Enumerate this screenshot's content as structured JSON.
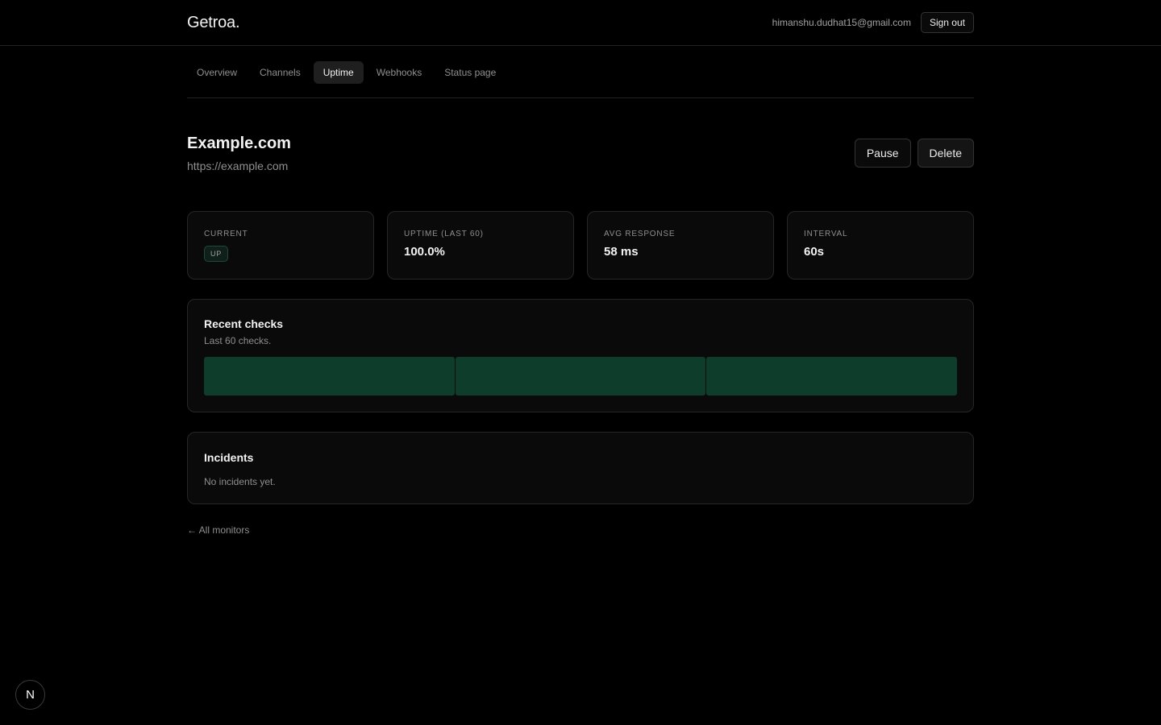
{
  "app": {
    "brand": "Getroa."
  },
  "header": {
    "user_email": "himanshu.dudhat15@gmail.com",
    "signout_label": "Sign out"
  },
  "nav": {
    "tabs": [
      {
        "label": "Overview",
        "active": false
      },
      {
        "label": "Channels",
        "active": false
      },
      {
        "label": "Uptime",
        "active": true
      },
      {
        "label": "Webhooks",
        "active": false
      },
      {
        "label": "Status page",
        "active": false
      }
    ]
  },
  "monitor": {
    "name": "Example.com",
    "url": "https://example.com",
    "pause_label": "Pause",
    "delete_label": "Delete"
  },
  "stats": {
    "current": {
      "label": "Current",
      "status": "UP"
    },
    "uptime": {
      "label": "Uptime (last 60)",
      "value": "100.0%"
    },
    "avg_response": {
      "label": "Avg response",
      "value": "58 ms"
    },
    "interval": {
      "label": "Interval",
      "value": "60s"
    }
  },
  "recent_checks": {
    "title": "Recent checks",
    "subtitle": "Last 60 checks.",
    "segments": [
      {
        "status": "up"
      },
      {
        "status": "up"
      },
      {
        "status": "up"
      }
    ]
  },
  "incidents": {
    "title": "Incidents",
    "empty_text": "No incidents yet."
  },
  "footer": {
    "back_link": "← All monitors",
    "dev_badge": "N"
  },
  "colors": {
    "background": "#000000",
    "card": "#0a0a0a",
    "border": "#262626",
    "check_up": "#0f3d2c",
    "text_muted": "#8f8f8f"
  }
}
